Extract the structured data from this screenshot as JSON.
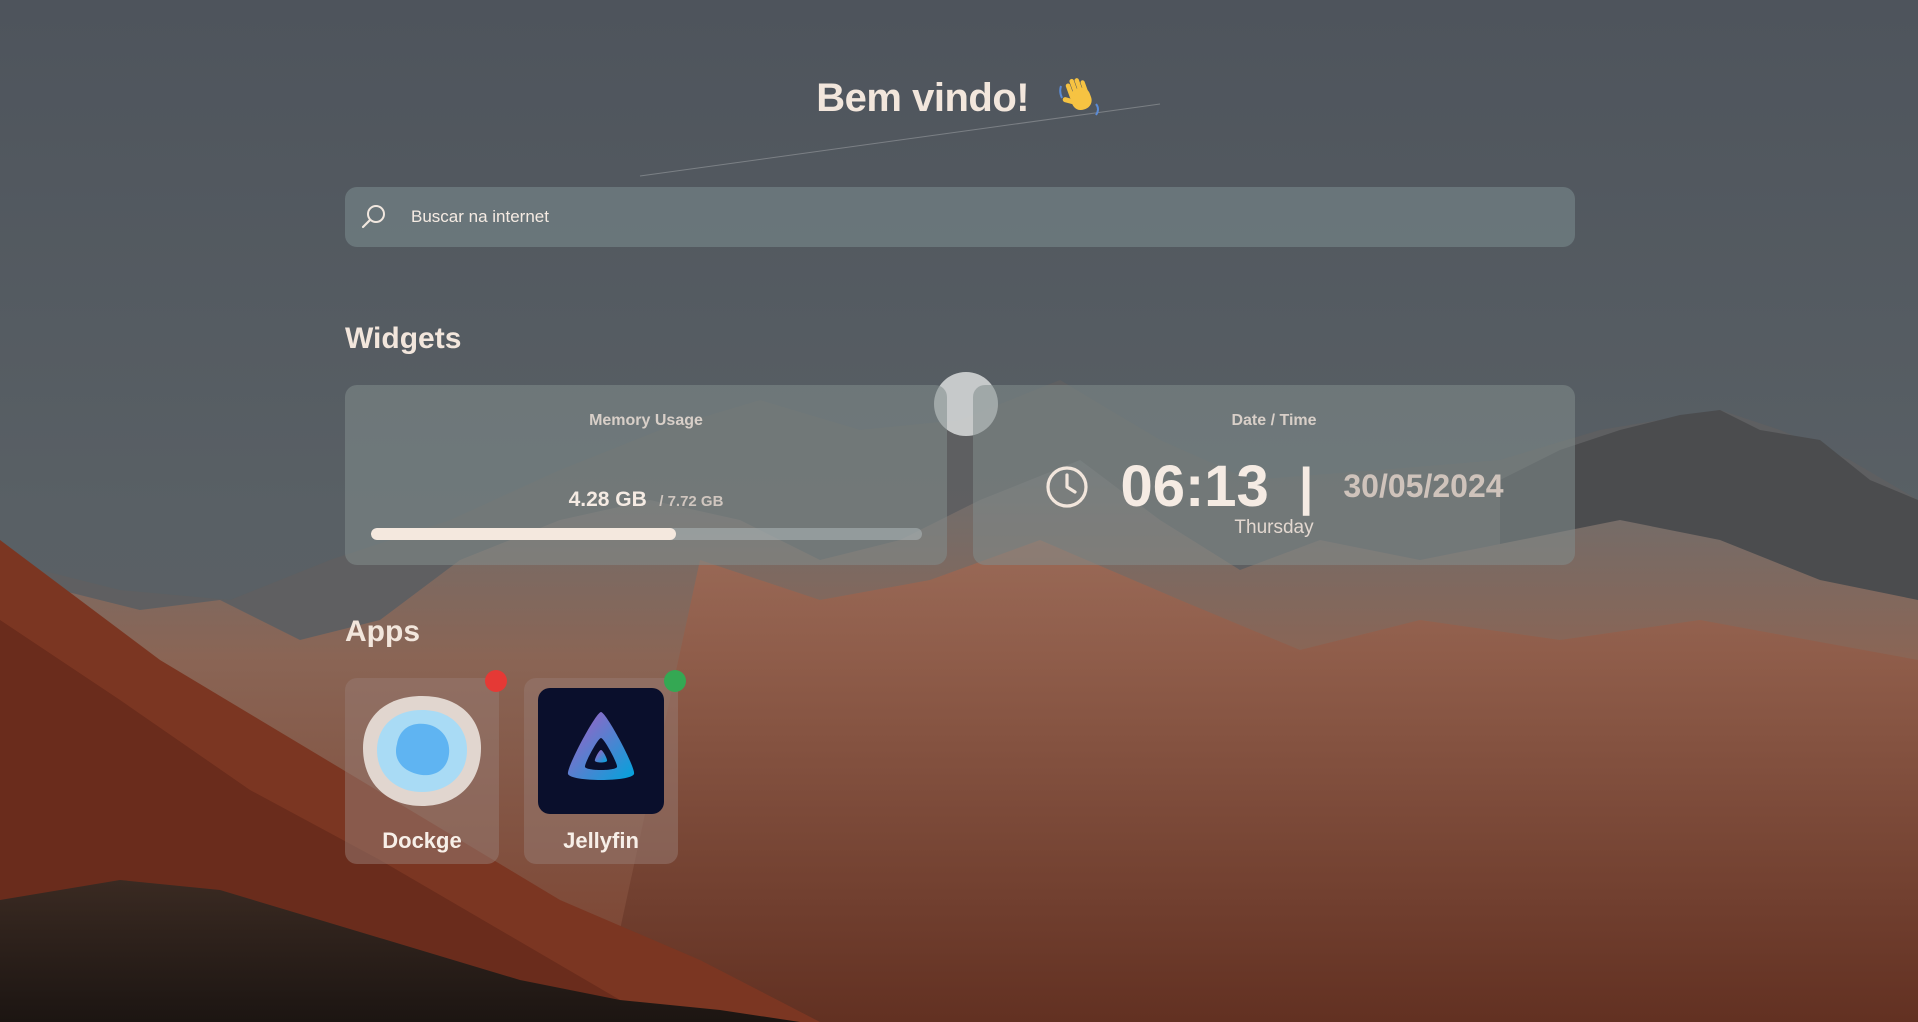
{
  "header": {
    "welcome_text": "Bem vindo!",
    "wave_icon": "waving-hand-icon"
  },
  "search": {
    "placeholder": "Buscar na internet",
    "icon": "search-icon"
  },
  "sections": {
    "widgets_title": "Widgets",
    "apps_title": "Apps"
  },
  "widgets": {
    "memory": {
      "label": "Memory Usage",
      "used": "4.28 GB",
      "total": "/ 7.72 GB",
      "used_fraction": 0.554
    },
    "datetime": {
      "label": "Date / Time",
      "time": "06:13",
      "separator": "|",
      "date": "30/05/2024",
      "day": "Thursday",
      "icon": "clock-icon"
    }
  },
  "apps": [
    {
      "name": "Dockge",
      "icon": "dockge-logo-icon",
      "status": "offline",
      "status_color": "#e53935"
    },
    {
      "name": "Jellyfin",
      "icon": "jellyfin-logo-icon",
      "status": "online",
      "status_color": "#34a853"
    }
  ],
  "colors": {
    "text_primary": "#f2e6dc",
    "panel": "#707e82",
    "progress_fill": "#f4e8de"
  }
}
